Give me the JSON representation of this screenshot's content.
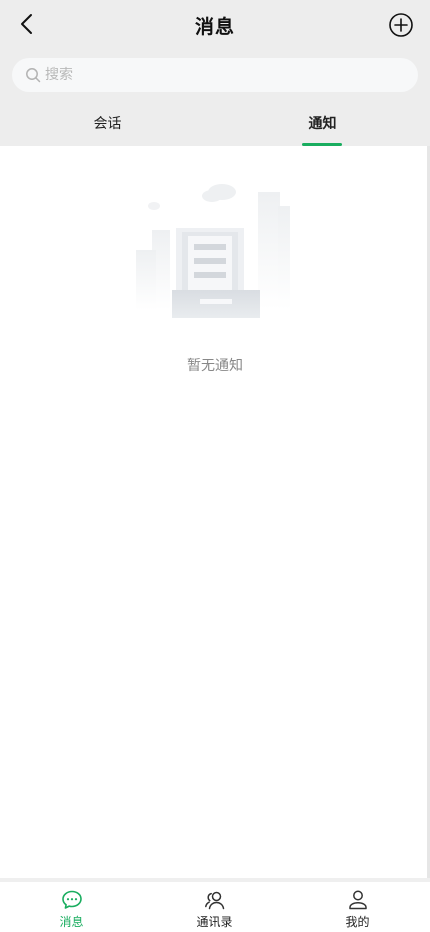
{
  "header": {
    "title": "消息",
    "back_icon": "chevron-left-icon",
    "add_icon": "plus-circle-icon"
  },
  "search": {
    "placeholder": "搜索",
    "value": ""
  },
  "tabs": [
    {
      "label": "会话",
      "active": false
    },
    {
      "label": "通知",
      "active": true
    }
  ],
  "empty_state": {
    "illustration": "empty-inbox-illustration",
    "text": "暂无通知"
  },
  "bottom_nav": [
    {
      "label": "消息",
      "icon": "chat-bubble-icon",
      "active": true
    },
    {
      "label": "通讯录",
      "icon": "contacts-icon",
      "active": false
    },
    {
      "label": "我的",
      "icon": "profile-icon",
      "active": false
    }
  ],
  "colors": {
    "accent": "#19ad5f",
    "header_bg": "#ededed",
    "search_bg": "#f7f8f9",
    "muted_text": "#888888"
  }
}
